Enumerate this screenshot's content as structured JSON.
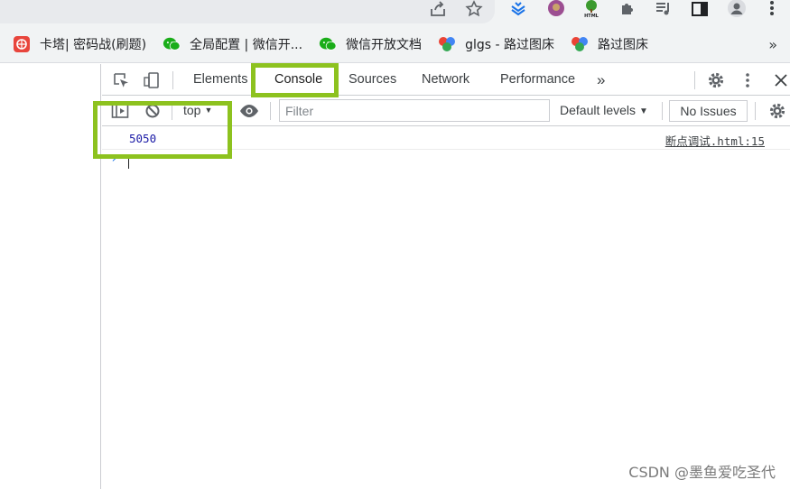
{
  "bookmarks": {
    "items": [
      {
        "label": "卡塔| 密码战(刷题)",
        "icon": "katahub-icon",
        "color": "#e8453c"
      },
      {
        "label": "全局配置 | 微信开...",
        "icon": "wechat-icon",
        "color": "#1aad19"
      },
      {
        "label": "微信开放文档",
        "icon": "wechat-icon",
        "color": "#1aad19"
      },
      {
        "label": "glgs - 路过图床",
        "icon": "colorful-dots-icon",
        "color": "#4285f4"
      },
      {
        "label": "路过图床",
        "icon": "colorful-dots-icon",
        "color": "#4285f4"
      }
    ],
    "more": "»"
  },
  "devtools": {
    "tabs": [
      {
        "label": "Elements",
        "active": false
      },
      {
        "label": "Console",
        "active": true
      },
      {
        "label": "Sources",
        "active": false
      },
      {
        "label": "Network",
        "active": false
      },
      {
        "label": "Performance",
        "active": false
      }
    ],
    "more_tabs": "»",
    "toolbar": {
      "context": "top",
      "filter_placeholder": "Filter",
      "levels": "Default levels",
      "issues": "No Issues"
    },
    "console": {
      "log_value": "5050",
      "log_source": "断点调试.html:15",
      "prompt": "›"
    }
  },
  "colors": {
    "accent": "#1a73e8",
    "highlight": "#8dc21f",
    "log_number": "#1a1aa6"
  },
  "watermark": "CSDN @墨鱼爱吃圣代"
}
